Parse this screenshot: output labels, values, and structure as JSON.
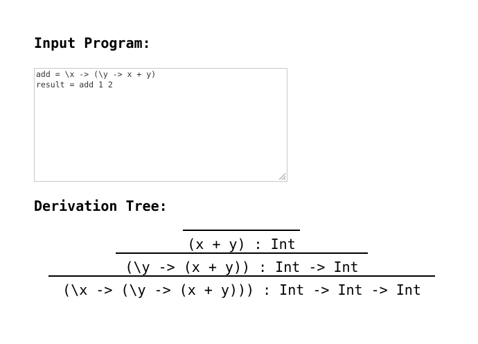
{
  "input_section": {
    "heading": "Input Program:",
    "program": "add = \\x -> (\\y -> x + y)\nresult = add 1 2"
  },
  "derivation_section": {
    "heading": "Derivation Tree:",
    "steps": [
      {
        "judgment": "(x + y) : Int"
      },
      {
        "judgment": "(\\y -> (x + y)) : Int -> Int"
      },
      {
        "judgment": "(\\x -> (\\y -> (x + y))) : Int -> Int -> Int"
      }
    ]
  }
}
